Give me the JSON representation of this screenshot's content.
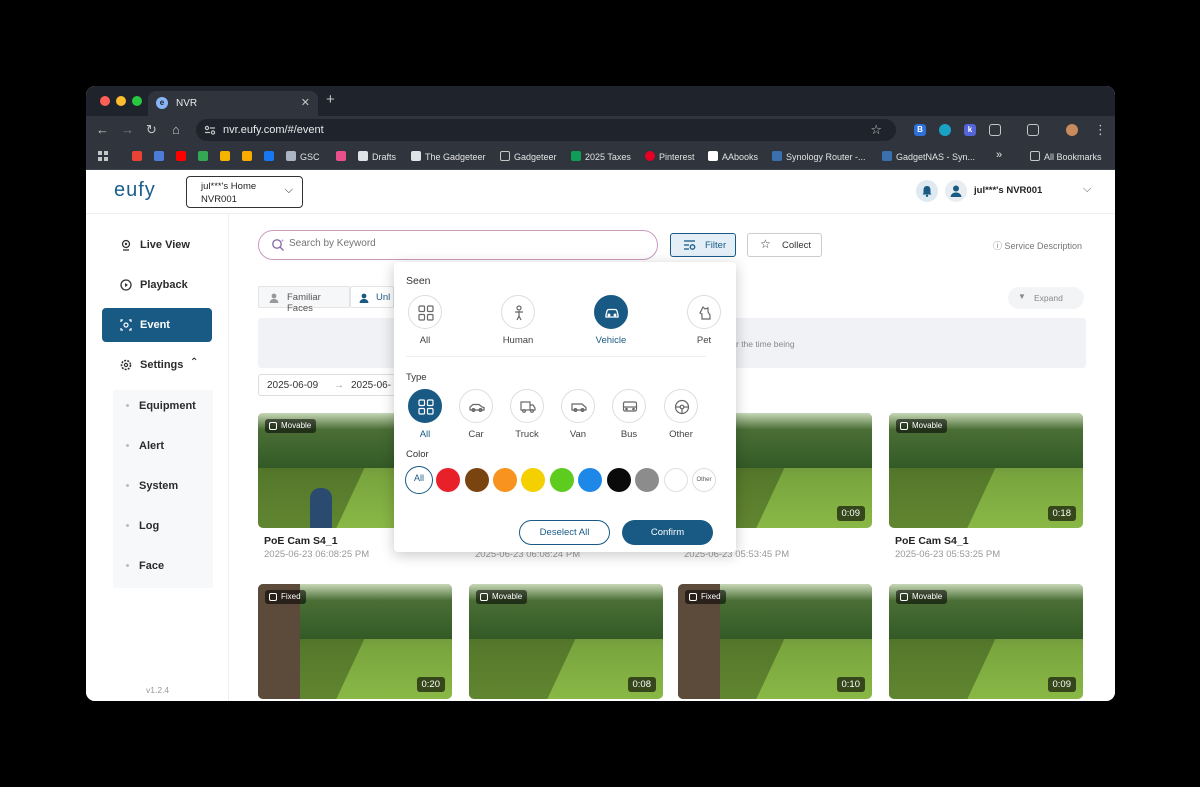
{
  "browser": {
    "tab_title": "NVR",
    "url": "nvr.eufy.com/#/event",
    "bookmarks": [
      "GSC",
      "Drafts",
      "The Gadgeteer",
      "Gadgeteer",
      "2025 Taxes",
      "Pinterest",
      "AAbooks",
      "Synology Router -...",
      "GadgetNAS - Syn...",
      "All Bookmarks"
    ]
  },
  "header": {
    "logo": "eufy",
    "home_line1": "jul***'s Home",
    "home_line2": "NVR001",
    "user": "jul***'s NVR001"
  },
  "sidebar": {
    "items": [
      {
        "label": "Live View",
        "icon": "location-pin-icon"
      },
      {
        "label": "Playback",
        "icon": "playback-icon"
      },
      {
        "label": "Event",
        "icon": "event-icon"
      },
      {
        "label": "Settings",
        "icon": "gear-icon"
      }
    ],
    "sub_items": [
      "Equipment",
      "Alert",
      "System",
      "Log",
      "Face"
    ],
    "version": "v1.2.4"
  },
  "main": {
    "search_placeholder": "Search by Keyword",
    "filter_label": "Filter",
    "collect_label": "Collect",
    "service_label": "Service Description",
    "face_tabs": [
      "Familiar Faces",
      "Unl"
    ],
    "expand_label": "Expand",
    "notice_text": "r the time being",
    "date_start": "2025-06-09",
    "date_sep": "→",
    "date_end": "2025-06-"
  },
  "cards": [
    {
      "badge": "Movable",
      "name": "PoE Cam S4_1",
      "time": "2025-06-23 06:08:25 PM",
      "duration": ""
    },
    {
      "badge": "",
      "name": "",
      "time": "2025-06-23 06:08:24 PM",
      "duration": ""
    },
    {
      "badge": "Movable",
      "name": "4_1",
      "time": "2025-06-23 05:53:45 PM",
      "duration": "0:09"
    },
    {
      "badge": "Movable",
      "name": "PoE Cam S4_1",
      "time": "2025-06-23 05:53:25 PM",
      "duration": "0:18"
    },
    {
      "badge": "Fixed",
      "name": "",
      "time": "",
      "duration": "0:20"
    },
    {
      "badge": "Movable",
      "name": "",
      "time": "",
      "duration": "0:08"
    },
    {
      "badge": "Fixed",
      "name": "",
      "time": "",
      "duration": "0:10"
    },
    {
      "badge": "Movable",
      "name": "",
      "time": "",
      "duration": "0:09"
    }
  ],
  "filter": {
    "seen_title": "Seen",
    "seen_options": [
      "All",
      "Human",
      "Vehicle",
      "Pet"
    ],
    "seen_selected": "Vehicle",
    "type_title": "Type",
    "type_options": [
      "All",
      "Car",
      "Truck",
      "Van",
      "Bus",
      "Other"
    ],
    "type_selected": "All",
    "color_title": "Color",
    "color_all": "All",
    "color_other": "Other",
    "colors": [
      "#e8202a",
      "#7a4410",
      "#f7931e",
      "#f5d000",
      "#5dcc1e",
      "#1e88e8",
      "#0a0a0a",
      "#8c8c8c",
      "#ffffff"
    ],
    "deselect_label": "Deselect All",
    "confirm_label": "Confirm"
  }
}
